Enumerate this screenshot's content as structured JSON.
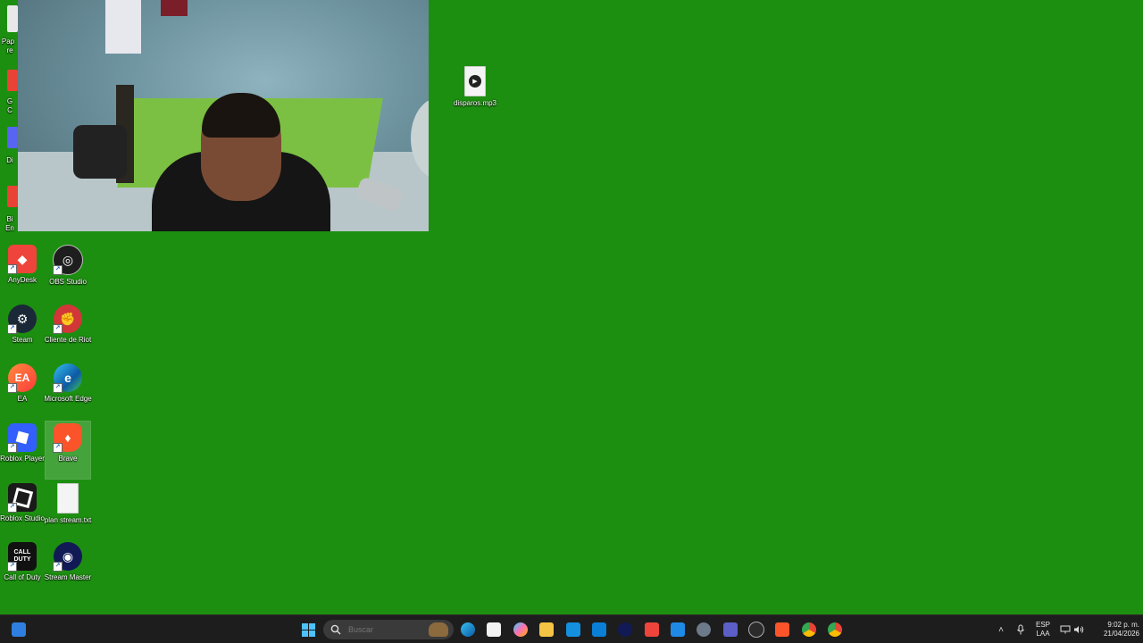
{
  "desktop": {
    "background_color": "#1c8f10",
    "left_partial_labels": [
      "Pap",
      "re",
      "G",
      "C",
      "Di",
      "Bi",
      "En"
    ],
    "icons": [
      {
        "label": "AnyDesk",
        "icon": "anydesk-icon",
        "color": "#ef443b"
      },
      {
        "label": "OBS Studio",
        "icon": "obs-icon",
        "color": "#1e1e1e"
      },
      {
        "label": "Steam",
        "icon": "steam-icon",
        "color": "#1b2838"
      },
      {
        "label": "Cliente de Riot",
        "icon": "riot-icon",
        "color": "#d13639"
      },
      {
        "label": "EA",
        "icon": "ea-icon",
        "color": "#ff4747"
      },
      {
        "label": "Microsoft Edge",
        "icon": "edge-icon",
        "color": "#0c59a4"
      },
      {
        "label": "Roblox Player",
        "icon": "roblox-icon",
        "color": "#335fff"
      },
      {
        "label": "Brave",
        "icon": "brave-icon",
        "color": "#fb542b"
      },
      {
        "label": "Roblox Studio",
        "icon": "roblox-studio-icon",
        "color": "#1a1a1a"
      },
      {
        "label": "plan stream.txt",
        "icon": "text-file-icon",
        "color": "#ffffff"
      },
      {
        "label": "Call of Duty",
        "icon": "cod-icon",
        "color": "#111111"
      },
      {
        "label": "Stream Master",
        "icon": "stream-master-icon",
        "color": "#111a55"
      }
    ],
    "file_icon": {
      "label": "disparos.mp3",
      "icon": "audio-file-icon"
    }
  },
  "taskbar": {
    "search_placeholder": "Buscar",
    "apps": [
      "edge-icon",
      "store-icon",
      "copilot-icon",
      "file-explorer-icon",
      "outlook-icon",
      "blue-app-icon",
      "stream-master-icon",
      "anydesk-icon",
      "blue-app-icon",
      "settings-icon",
      "teams-icon",
      "obs-icon",
      "brave-icon",
      "chrome-icon",
      "chrome-icon"
    ],
    "tray": {
      "lang_line1": "ESP",
      "lang_line2": "LAA",
      "time": "9:02 p. m.",
      "date": "21/04/2026"
    }
  }
}
